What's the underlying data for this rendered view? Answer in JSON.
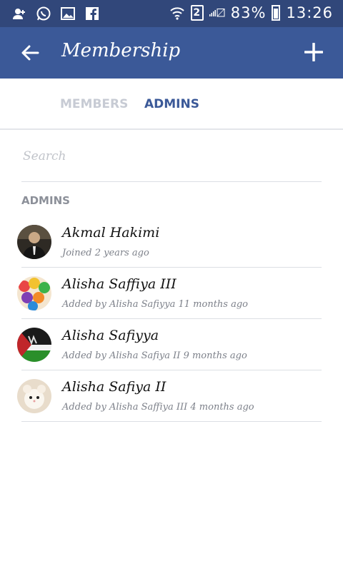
{
  "status_bar": {
    "sim_slot": "2",
    "battery": "83%",
    "time": "13:26",
    "battery_level": 0.83,
    "icons": [
      "person-add-icon",
      "whatsapp-icon",
      "gallery-icon",
      "facebook-icon",
      "wifi-icon",
      "sim-icon",
      "signal-icon",
      "battery-icon"
    ]
  },
  "app_bar": {
    "title": "Membership",
    "back_icon": "arrow-left-icon",
    "add_icon": "plus-icon",
    "color": "#3b5998"
  },
  "tabs": [
    {
      "label": "MEMBERS",
      "active": false
    },
    {
      "label": "ADMINS",
      "active": true
    }
  ],
  "search": {
    "placeholder": "Search",
    "value": ""
  },
  "section": {
    "label": "ADMINS"
  },
  "admins": [
    {
      "name": "Akmal Hakimi",
      "detail": "Joined 2 years ago"
    },
    {
      "name": "Alisha Saffiya III",
      "detail": "Added by Alisha Safiyya 11 months ago"
    },
    {
      "name": "Alisha Safiyya",
      "detail": "Added by Alisha Safiya II 9 months ago"
    },
    {
      "name": "Alisha Safiya II",
      "detail": "Added by Alisha Saffiya III 4 months ago"
    }
  ]
}
